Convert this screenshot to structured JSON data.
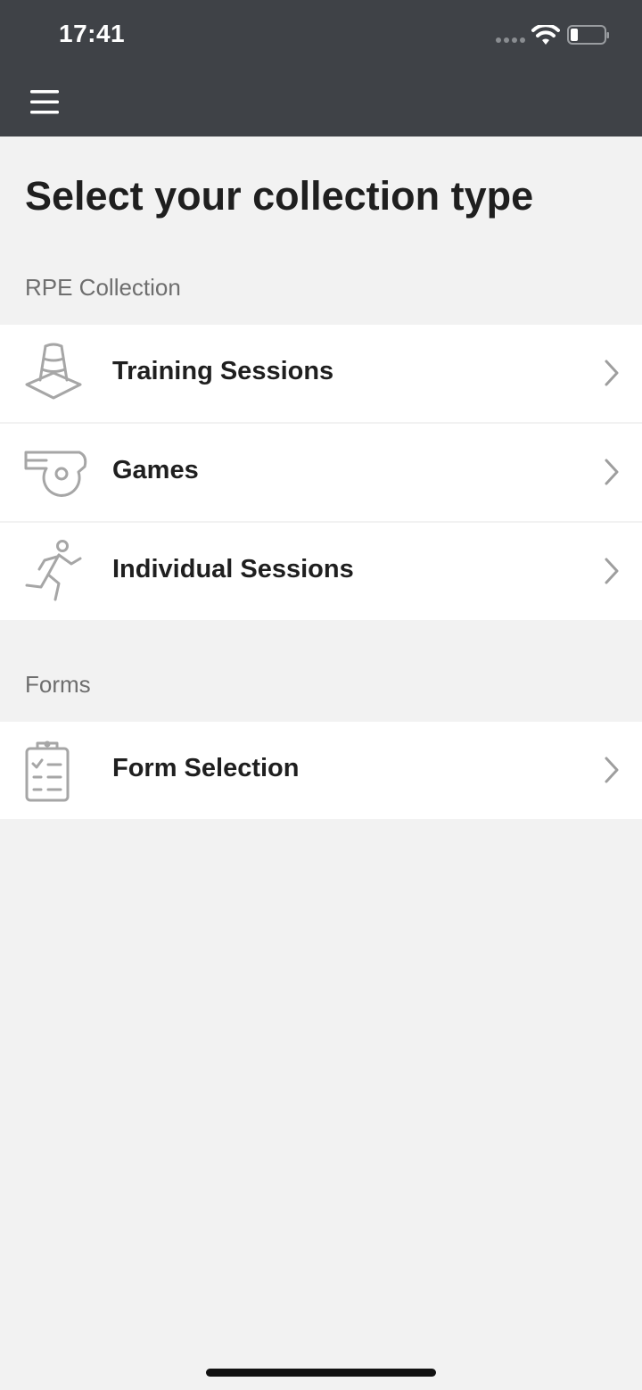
{
  "status_bar": {
    "time": "17:41"
  },
  "icons": {
    "menu": "hamburger-menu-icon",
    "signal": "cellular-signal-icon",
    "wifi": "wifi-icon",
    "battery": "battery-icon",
    "chevron": "chevron-right-icon"
  },
  "colors": {
    "header_bg": "#3f4247",
    "page_bg": "#f2f2f2",
    "row_bg": "#ffffff",
    "icon_gray": "#a6a6a6",
    "title_text": "#1f1f1f",
    "section_text": "#6e6e6e"
  },
  "page": {
    "title": "Select your collection type"
  },
  "sections": [
    {
      "header": "RPE Collection",
      "items": [
        {
          "label": "Training Sessions",
          "icon": "training-cone-icon"
        },
        {
          "label": "Games",
          "icon": "whistle-icon"
        },
        {
          "label": "Individual Sessions",
          "icon": "running-person-icon"
        }
      ]
    },
    {
      "header": "Forms",
      "items": [
        {
          "label": "Form Selection",
          "icon": "clipboard-checklist-icon"
        }
      ]
    }
  ]
}
